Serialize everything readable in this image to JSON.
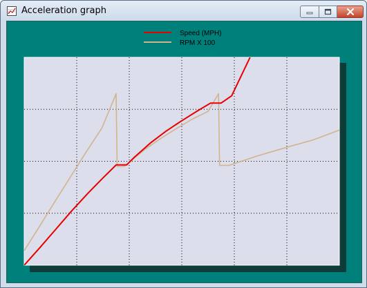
{
  "window": {
    "title": "Acceleration graph"
  },
  "icons": {
    "app": "graph-icon",
    "minimize": "minimize-icon",
    "maximize": "maximize-icon",
    "close": "close-icon"
  },
  "colors": {
    "background": "#00807A",
    "plot_area": "#DCDEEC",
    "shadow": "#0E3D39",
    "speed": "#E60000",
    "rpm": "#D2B48C",
    "grid": "#000000"
  },
  "chart_data": {
    "type": "line",
    "title": "",
    "xlabel": "",
    "ylabel": "",
    "grid": true,
    "grid_style": "dotted",
    "legend_placement": "top-center",
    "xlim": [
      0,
      6
    ],
    "ylim": [
      0,
      4
    ],
    "series": [
      {
        "name": "Speed (MPH)",
        "color": "#E60000",
        "points": [
          [
            0,
            0
          ],
          [
            0.3,
            0.34
          ],
          [
            0.6,
            0.69
          ],
          [
            0.9,
            1.04
          ],
          [
            1.2,
            1.37
          ],
          [
            1.5,
            1.68
          ],
          [
            1.75,
            1.93
          ],
          [
            1.95,
            1.93
          ],
          [
            2.1,
            2.08
          ],
          [
            2.4,
            2.35
          ],
          [
            2.7,
            2.58
          ],
          [
            3.0,
            2.78
          ],
          [
            3.3,
            2.97
          ],
          [
            3.55,
            3.12
          ],
          [
            3.75,
            3.12
          ],
          [
            3.95,
            3.26
          ],
          [
            4.3,
            4.0
          ]
        ]
      },
      {
        "name": "RPM X 100",
        "color": "#D2B48C",
        "points": [
          [
            0,
            0.28
          ],
          [
            0.3,
            0.76
          ],
          [
            0.6,
            1.25
          ],
          [
            0.9,
            1.73
          ],
          [
            1.2,
            2.21
          ],
          [
            1.48,
            2.64
          ],
          [
            1.75,
            3.3
          ],
          [
            1.77,
            1.9
          ],
          [
            1.9,
            1.9
          ],
          [
            2.0,
            1.98
          ],
          [
            2.3,
            2.23
          ],
          [
            2.6,
            2.44
          ],
          [
            2.9,
            2.63
          ],
          [
            3.2,
            2.81
          ],
          [
            3.5,
            2.96
          ],
          [
            3.7,
            3.3
          ],
          [
            3.72,
            1.92
          ],
          [
            3.9,
            1.92
          ],
          [
            4.4,
            2.09
          ],
          [
            5.0,
            2.27
          ],
          [
            5.5,
            2.41
          ],
          [
            6.0,
            2.6
          ]
        ]
      }
    ]
  }
}
